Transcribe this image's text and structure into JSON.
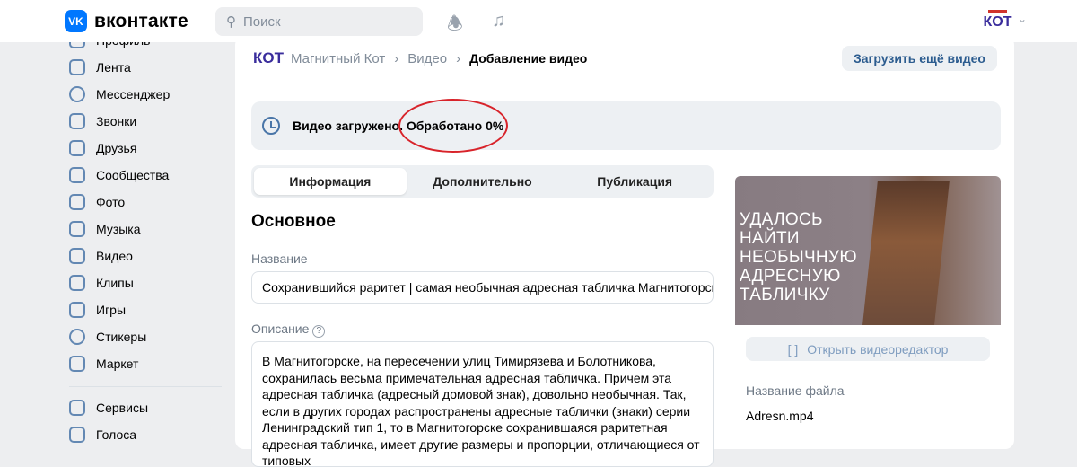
{
  "header": {
    "logo": "вконтакте",
    "vk_badge": "VK",
    "search_placeholder": "Поиск",
    "avatar_text": "КОТ"
  },
  "sidebar": {
    "items": [
      {
        "label": "Профиль"
      },
      {
        "label": "Лента"
      },
      {
        "label": "Мессенджер"
      },
      {
        "label": "Звонки"
      },
      {
        "label": "Друзья"
      },
      {
        "label": "Сообщества"
      },
      {
        "label": "Фото"
      },
      {
        "label": "Музыка"
      },
      {
        "label": "Видео"
      },
      {
        "label": "Клипы"
      },
      {
        "label": "Игры"
      },
      {
        "label": "Стикеры"
      },
      {
        "label": "Маркет"
      }
    ],
    "items2": [
      {
        "label": "Сервисы"
      },
      {
        "label": "Голоса"
      }
    ]
  },
  "breadcrumb": {
    "logo": "КОТ",
    "items": [
      "Магнитный Кот",
      "Видео"
    ],
    "current": "Добавление видео"
  },
  "upload_more": "Загрузить ещё видео",
  "status": {
    "text": "Видео загружено. Обработано 0%",
    "processed_percent": 0
  },
  "tabs": [
    "Информация",
    "Дополнительно",
    "Публикация"
  ],
  "section_title": "Основное",
  "title_label": "Название",
  "title_value": "Сохранившийся раритет | самая необычная адресная табличка Магнитогорска",
  "desc_label": "Описание",
  "desc_value": "В Магнитогорске, на пересечении улиц Тимирязева и Болотникова, сохранилась весьма примечательная адресная табличка. Причем эта адресная табличка (адресный домовой знак), довольно необычная. Так, если в других городах распространены адресные таблички (знаки) серии Ленинградский тип 1, то в Магнитогорске сохранившаяся раритетная адресная табличка, имеет другие размеры и пропорции, отличающиеся от типовых",
  "thumb_text": "УДАЛОСЬ НАЙТИ НЕОБЫЧНУЮ АДРЕСНУЮ ТАБЛИЧКУ",
  "editor_button": "Открыть видеоредактор",
  "file_label": "Название файла",
  "file_name": "Adresn.mp4"
}
